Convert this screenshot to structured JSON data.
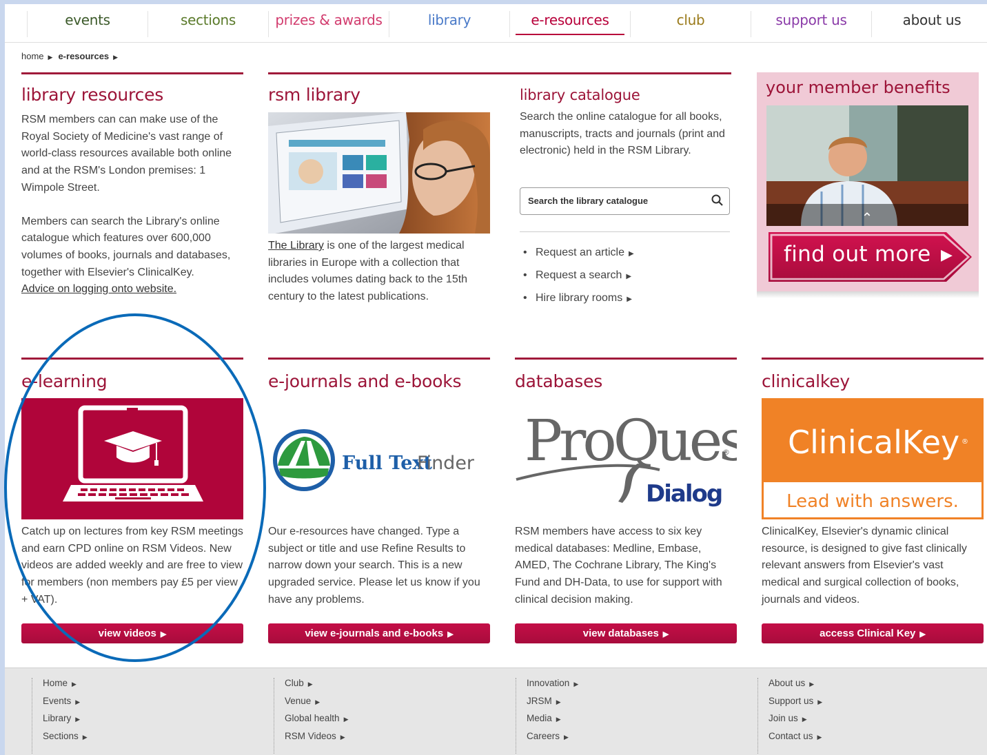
{
  "nav": [
    {
      "label": "events",
      "color": "#3c5a2a"
    },
    {
      "label": "sections",
      "color": "#5a7a2a"
    },
    {
      "label": "prizes & awards",
      "color": "#d23c6e"
    },
    {
      "label": "library",
      "color": "#4a7ac8"
    },
    {
      "label": "e-resources",
      "color": "#b8003a"
    },
    {
      "label": "club",
      "color": "#9a7a1a"
    },
    {
      "label": "support us",
      "color": "#8a3aa8"
    },
    {
      "label": "about us",
      "color": "#333333"
    }
  ],
  "breadcrumb": {
    "home": "home",
    "current": "e-resources"
  },
  "library_resources": {
    "heading": "library resources",
    "para1": "RSM members can can make use of the Royal Society of Medicine's vast range of world-class resources available both online and at the RSM's London premises: 1 Wimpole Street.",
    "para2": "Members can search the Library's online catalogue which features over 600,000 volumes of books, journals and databases, together with Elsevier's ClinicalKey.",
    "link": "Advice on logging onto website."
  },
  "rsm_library": {
    "heading": "rsm library",
    "link": "The Library",
    "text": " is one of the largest medical libraries in Europe with a collection that includes volumes dating back to the 15th century to the latest publications."
  },
  "catalogue": {
    "heading": "library catalogue",
    "text": "Search the online catalogue for all books, manuscripts, tracts and journals (print and electronic) held in the RSM Library.",
    "search_placeholder": "Search the library catalogue",
    "links": [
      "Request an article",
      "Request a search",
      "Hire library rooms"
    ]
  },
  "benefits": {
    "title": "your member benefits",
    "button": "find out more"
  },
  "elearning": {
    "heading": "e-learning",
    "text": "Catch up on lectures from key RSM meetings and earn CPD online on RSM Videos. New videos are added weekly and are free to view for members (non members pay £5 per view + VAT).",
    "button": "view videos"
  },
  "ejournals": {
    "heading": "e-journals and e-books",
    "logo_text1": "Full Text",
    "logo_text2": "Finder",
    "text": "Our e-resources have changed. Type a subject or title and use Refine Results to narrow down your search. This is a new upgraded service. Please let us know if you have any problems.",
    "button": "view e-journals and e-books"
  },
  "databases": {
    "heading": "databases",
    "logo_text": "ProQuest",
    "logo_reg": "®",
    "logo_sub": "Dialog",
    "text": "RSM members have access to six key medical databases: Medline, Embase, AMED, The Cochrane Library, The King's Fund and DH-Data, to use for support with clinical decision making.",
    "button": "view databases"
  },
  "clinicalkey": {
    "heading": "clinicalkey",
    "logo_text": "ClinicalKey",
    "logo_mark": "®",
    "tagline": "Lead with answers.",
    "text": "ClinicalKey, Elsevier's dynamic clinical resource, is designed to give fast clinically relevant answers from Elsevier's vast medical and surgical collection of books, journals and videos.",
    "button": "access Clinical Key"
  },
  "footer": [
    [
      "Home",
      "Events",
      "Library",
      "Sections"
    ],
    [
      "Club",
      "Venue",
      "Global health",
      "RSM Videos"
    ],
    [
      "Innovation",
      "JRSM",
      "Media",
      "Careers"
    ],
    [
      "About us",
      "Support us",
      "Join us",
      "Contact us"
    ]
  ],
  "colors": {
    "accent": "#a01a3a",
    "annotation": "#0a6ab8",
    "clinicalkey_orange": "#f08226"
  }
}
